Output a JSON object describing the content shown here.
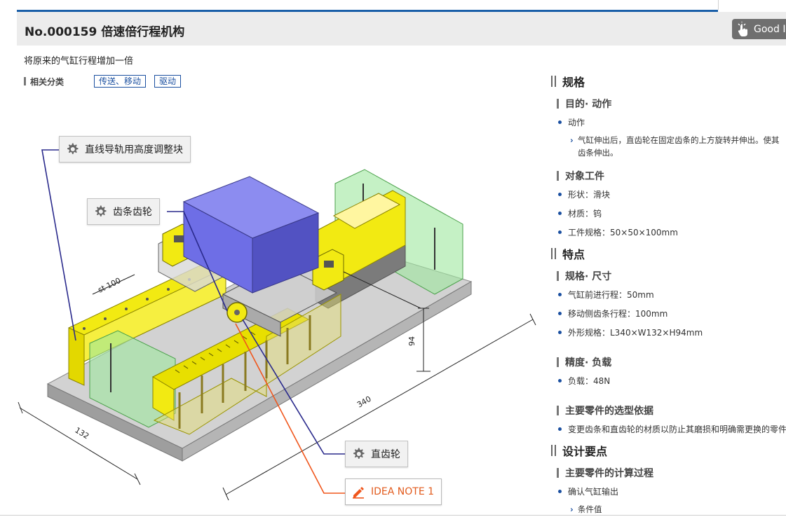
{
  "header": {
    "title": "No.000159 倍速倍行程机构",
    "good_idea_label": "Good ID"
  },
  "subtitle": "将原来的气缸行程增加一倍",
  "categories": {
    "label": "相关分类",
    "tags": [
      "传送、移动",
      "驱动"
    ]
  },
  "diagram": {
    "callouts": {
      "rail_block": "直线导轨用高度调整块",
      "rack_gear": "齿条齿轮",
      "spur_gear": "直齿轮",
      "idea_note": "IDEA NOTE 1"
    },
    "dimensions": {
      "stroke": "st 100",
      "height": "94",
      "length": "340",
      "width": "132"
    },
    "colors": {
      "workpiece": "#7777dd",
      "rail_yellow": "#f2ea12",
      "guard_green": "#8fdc8f",
      "base_gray": "#c8c8c8",
      "leader_blue": "#2a2a8c",
      "leader_orange": "#f0561c"
    }
  },
  "spec": {
    "title": "规格",
    "purpose": {
      "title": "目的· 动作",
      "item_label": "动作",
      "detail_line1": "气缸伸出后，直齿轮在固定齿条的上方旋转并伸出。使其",
      "detail_line2": "齿条伸出。"
    },
    "workpiece": {
      "title": "对象工件",
      "shape": "形状：滑块",
      "material": "材质：钨",
      "size": "工件规格：50×50×100mm"
    }
  },
  "features": {
    "title": "特点",
    "dimensions": {
      "title": "规格· 尺寸",
      "cyl_stroke": "气缸前进行程：50mm",
      "rack_stroke": "移动侧齿条行程：100mm",
      "outline": "外形规格：L340×W132×H94mm"
    },
    "accuracy": {
      "title": "精度· 负载",
      "load": "负载：48N"
    },
    "selection": {
      "title": "主要零件的选型依据",
      "item": "变更齿条和直齿轮的材质以防止其磨损和明确需更换的零件"
    }
  },
  "design": {
    "title": "设计要点",
    "calc": {
      "title": "主要零件的计算过程",
      "item": "确认气缸输出",
      "sub": "条件值"
    }
  }
}
